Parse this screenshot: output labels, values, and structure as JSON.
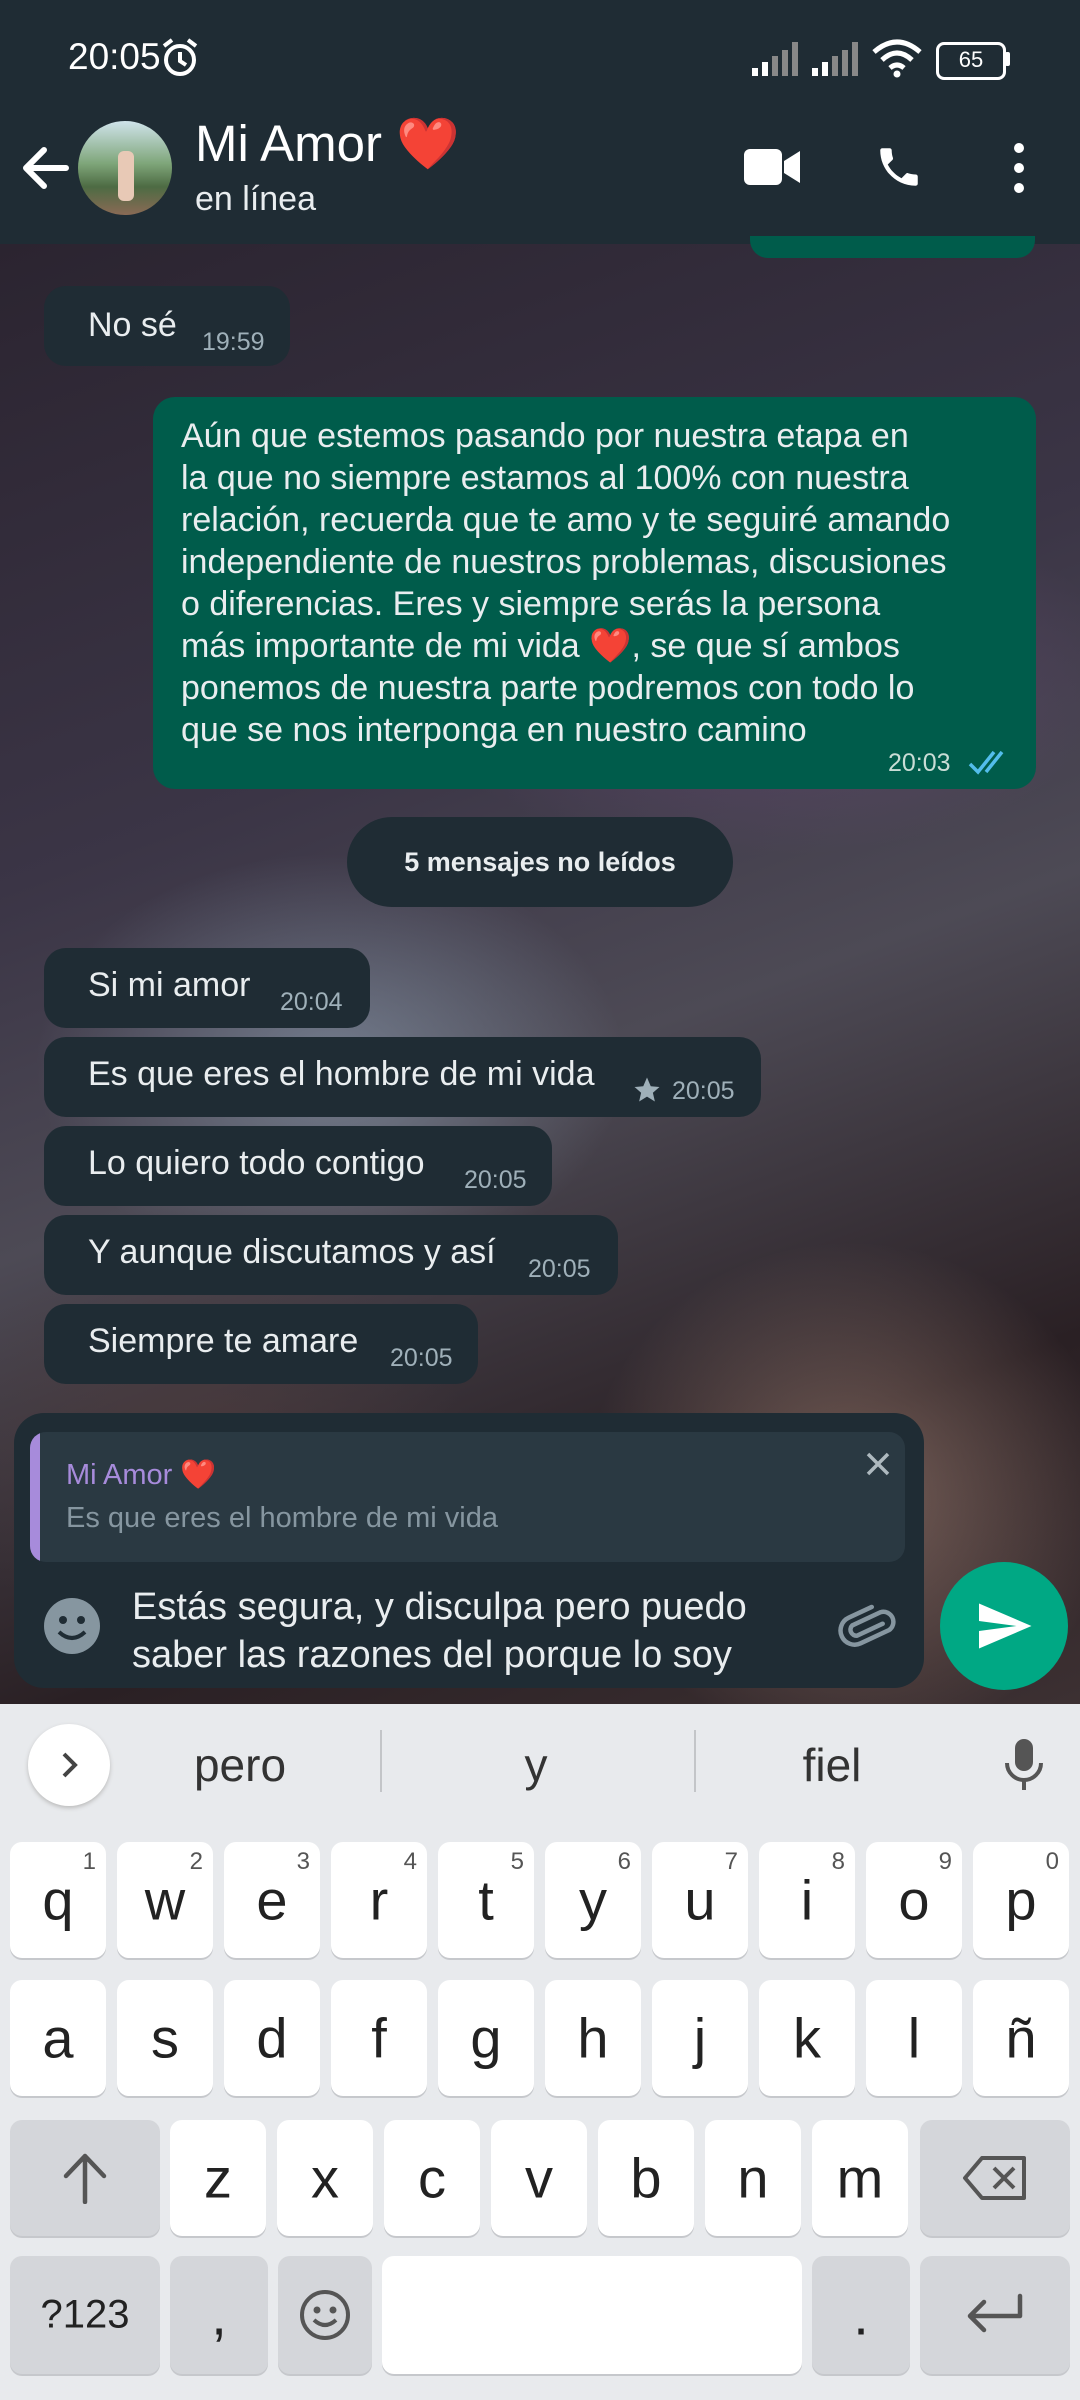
{
  "status_bar": {
    "time": "20:05",
    "battery": "65"
  },
  "header": {
    "contact_name": "Mi Amor ❤️",
    "status": "en línea"
  },
  "messages": [
    {
      "text": "No sé",
      "time": "19:59"
    },
    {
      "lines": [
        "Aún que estemos pasando por nuestra etapa en",
        "la que no siempre estamos al 100% con nuestra",
        "relación, recuerda que te amo y te seguiré amando",
        "independiente de nuestros problemas, discusiones",
        "o diferencias. Eres y siempre serás la persona",
        "más importante de mi vida ❤️, se que sí ambos",
        "ponemos de nuestra parte podremos con todo lo",
        "que se nos interponga en nuestro camino"
      ],
      "time": "20:03"
    },
    {
      "text": "Si mi amor",
      "time": "20:04"
    },
    {
      "text": "Es que eres el hombre de mi vida",
      "time": "20:05"
    },
    {
      "text": "Lo quiero todo contigo",
      "time": "20:05"
    },
    {
      "text": "Y aunque discutamos y así",
      "time": "20:05"
    },
    {
      "text": "Siempre te amare",
      "time": "20:05"
    }
  ],
  "unread_banner": "5 mensajes no leídos",
  "composer": {
    "reply_name": "Mi Amor ❤️",
    "reply_text": "Es que eres el hombre de mi vida",
    "input_value": "Estás segura, y disculpa pero puedo saber las razones del porque lo soy"
  },
  "keyboard": {
    "suggestions": [
      "pero",
      "y",
      "fiel"
    ],
    "row1": [
      "q",
      "w",
      "e",
      "r",
      "t",
      "y",
      "u",
      "i",
      "o",
      "p"
    ],
    "row1_numbers": [
      "1",
      "2",
      "3",
      "4",
      "5",
      "6",
      "7",
      "8",
      "9",
      "0"
    ],
    "row2": [
      "a",
      "s",
      "d",
      "f",
      "g",
      "h",
      "j",
      "k",
      "l",
      "ñ"
    ],
    "row3": [
      "z",
      "x",
      "c",
      "v",
      "b",
      "n",
      "m"
    ],
    "symbols_key": "?123",
    "comma_key": ",",
    "period_key": "."
  },
  "colors": {
    "outgoing": "#005c4b",
    "incoming": "#1f2c34",
    "send_button": "#00a884",
    "accent_read": "#53bdeb"
  },
  "icons": [
    "alarm-icon",
    "signal-icon",
    "wifi-icon",
    "battery-icon",
    "back-arrow-icon",
    "video-call-icon",
    "phone-icon",
    "more-vert-icon",
    "read-receipt-icon",
    "star-icon",
    "close-icon",
    "emoji-icon",
    "attach-icon",
    "send-icon",
    "chevron-right-icon",
    "mic-icon",
    "shift-icon",
    "backspace-icon",
    "enter-icon"
  ]
}
